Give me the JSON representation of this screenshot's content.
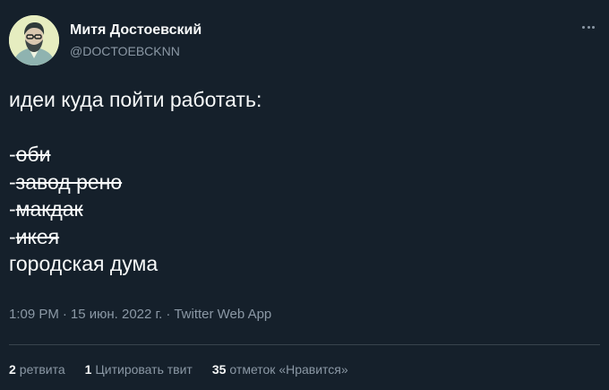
{
  "author": {
    "name": "Митя Достоевский",
    "handle": "@DOCTOEBCKNN"
  },
  "menu": {
    "icon": "more-horizontal-icon"
  },
  "tweet": {
    "lines": [
      {
        "prefix": "",
        "text": "идеи куда пойти работать:",
        "struck": false
      },
      {
        "prefix": "",
        "text": "",
        "struck": false
      },
      {
        "prefix": "-",
        "text": "оби",
        "struck": true
      },
      {
        "prefix": "-",
        "text": "завод рено",
        "struck": true
      },
      {
        "prefix": "-",
        "text": "макдак",
        "struck": true
      },
      {
        "prefix": "-",
        "text": "икея",
        "struck": true
      },
      {
        "prefix": "",
        "text": "городская дума",
        "struck": false
      }
    ]
  },
  "meta": {
    "time": "1:09 PM",
    "separator": "·",
    "date": "15 июн. 2022 г.",
    "source": "Twitter Web App"
  },
  "stats": {
    "retweets": {
      "count": "2",
      "label": "ретвита"
    },
    "quotes": {
      "count": "1",
      "label": "Цитировать твит"
    },
    "likes": {
      "count": "35",
      "label": "отметок «Нравится»"
    }
  },
  "colors": {
    "background": "#15202b",
    "primary_text": "#f7f9f9",
    "secondary_text": "#8b98a5",
    "divider": "#38444d"
  }
}
